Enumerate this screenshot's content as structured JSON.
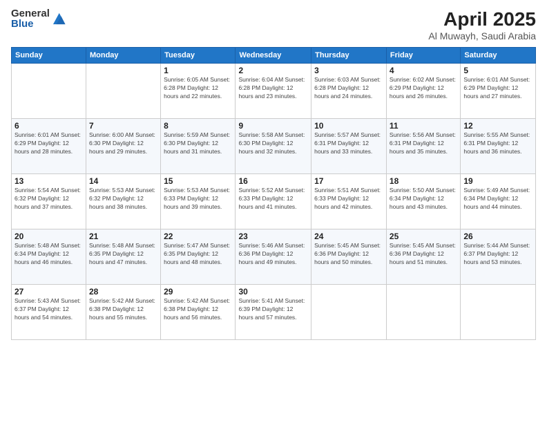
{
  "logo": {
    "general": "General",
    "blue": "Blue"
  },
  "title": {
    "month": "April 2025",
    "location": "Al Muwayh, Saudi Arabia"
  },
  "headers": [
    "Sunday",
    "Monday",
    "Tuesday",
    "Wednesday",
    "Thursday",
    "Friday",
    "Saturday"
  ],
  "weeks": [
    [
      {
        "day": "",
        "info": ""
      },
      {
        "day": "",
        "info": ""
      },
      {
        "day": "1",
        "info": "Sunrise: 6:05 AM\nSunset: 6:28 PM\nDaylight: 12 hours and 22 minutes."
      },
      {
        "day": "2",
        "info": "Sunrise: 6:04 AM\nSunset: 6:28 PM\nDaylight: 12 hours and 23 minutes."
      },
      {
        "day": "3",
        "info": "Sunrise: 6:03 AM\nSunset: 6:28 PM\nDaylight: 12 hours and 24 minutes."
      },
      {
        "day": "4",
        "info": "Sunrise: 6:02 AM\nSunset: 6:29 PM\nDaylight: 12 hours and 26 minutes."
      },
      {
        "day": "5",
        "info": "Sunrise: 6:01 AM\nSunset: 6:29 PM\nDaylight: 12 hours and 27 minutes."
      }
    ],
    [
      {
        "day": "6",
        "info": "Sunrise: 6:01 AM\nSunset: 6:29 PM\nDaylight: 12 hours and 28 minutes."
      },
      {
        "day": "7",
        "info": "Sunrise: 6:00 AM\nSunset: 6:30 PM\nDaylight: 12 hours and 29 minutes."
      },
      {
        "day": "8",
        "info": "Sunrise: 5:59 AM\nSunset: 6:30 PM\nDaylight: 12 hours and 31 minutes."
      },
      {
        "day": "9",
        "info": "Sunrise: 5:58 AM\nSunset: 6:30 PM\nDaylight: 12 hours and 32 minutes."
      },
      {
        "day": "10",
        "info": "Sunrise: 5:57 AM\nSunset: 6:31 PM\nDaylight: 12 hours and 33 minutes."
      },
      {
        "day": "11",
        "info": "Sunrise: 5:56 AM\nSunset: 6:31 PM\nDaylight: 12 hours and 35 minutes."
      },
      {
        "day": "12",
        "info": "Sunrise: 5:55 AM\nSunset: 6:31 PM\nDaylight: 12 hours and 36 minutes."
      }
    ],
    [
      {
        "day": "13",
        "info": "Sunrise: 5:54 AM\nSunset: 6:32 PM\nDaylight: 12 hours and 37 minutes."
      },
      {
        "day": "14",
        "info": "Sunrise: 5:53 AM\nSunset: 6:32 PM\nDaylight: 12 hours and 38 minutes."
      },
      {
        "day": "15",
        "info": "Sunrise: 5:53 AM\nSunset: 6:33 PM\nDaylight: 12 hours and 39 minutes."
      },
      {
        "day": "16",
        "info": "Sunrise: 5:52 AM\nSunset: 6:33 PM\nDaylight: 12 hours and 41 minutes."
      },
      {
        "day": "17",
        "info": "Sunrise: 5:51 AM\nSunset: 6:33 PM\nDaylight: 12 hours and 42 minutes."
      },
      {
        "day": "18",
        "info": "Sunrise: 5:50 AM\nSunset: 6:34 PM\nDaylight: 12 hours and 43 minutes."
      },
      {
        "day": "19",
        "info": "Sunrise: 5:49 AM\nSunset: 6:34 PM\nDaylight: 12 hours and 44 minutes."
      }
    ],
    [
      {
        "day": "20",
        "info": "Sunrise: 5:48 AM\nSunset: 6:34 PM\nDaylight: 12 hours and 46 minutes."
      },
      {
        "day": "21",
        "info": "Sunrise: 5:48 AM\nSunset: 6:35 PM\nDaylight: 12 hours and 47 minutes."
      },
      {
        "day": "22",
        "info": "Sunrise: 5:47 AM\nSunset: 6:35 PM\nDaylight: 12 hours and 48 minutes."
      },
      {
        "day": "23",
        "info": "Sunrise: 5:46 AM\nSunset: 6:36 PM\nDaylight: 12 hours and 49 minutes."
      },
      {
        "day": "24",
        "info": "Sunrise: 5:45 AM\nSunset: 6:36 PM\nDaylight: 12 hours and 50 minutes."
      },
      {
        "day": "25",
        "info": "Sunrise: 5:45 AM\nSunset: 6:36 PM\nDaylight: 12 hours and 51 minutes."
      },
      {
        "day": "26",
        "info": "Sunrise: 5:44 AM\nSunset: 6:37 PM\nDaylight: 12 hours and 53 minutes."
      }
    ],
    [
      {
        "day": "27",
        "info": "Sunrise: 5:43 AM\nSunset: 6:37 PM\nDaylight: 12 hours and 54 minutes."
      },
      {
        "day": "28",
        "info": "Sunrise: 5:42 AM\nSunset: 6:38 PM\nDaylight: 12 hours and 55 minutes."
      },
      {
        "day": "29",
        "info": "Sunrise: 5:42 AM\nSunset: 6:38 PM\nDaylight: 12 hours and 56 minutes."
      },
      {
        "day": "30",
        "info": "Sunrise: 5:41 AM\nSunset: 6:39 PM\nDaylight: 12 hours and 57 minutes."
      },
      {
        "day": "",
        "info": ""
      },
      {
        "day": "",
        "info": ""
      },
      {
        "day": "",
        "info": ""
      }
    ]
  ]
}
